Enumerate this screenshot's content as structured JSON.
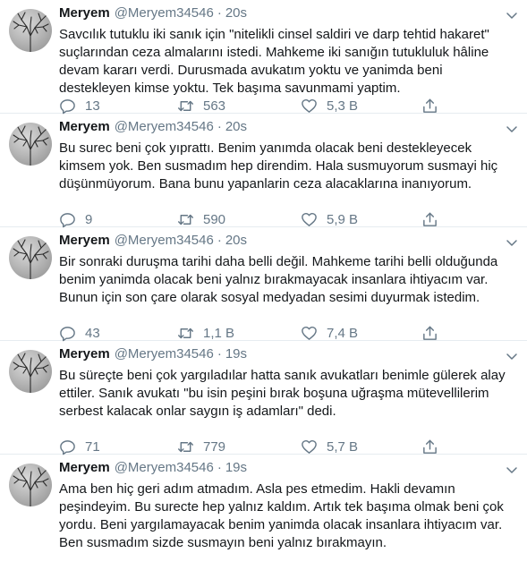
{
  "tweets": [
    {
      "name": "Meryem",
      "handle": "@Meryem34546",
      "dot": "·",
      "time": "20s",
      "lines": [
        "Savcılık tutuklu iki sanık için \"nitelikli cinsel saldiri ve darp tehtid hakaret\"",
        "suçlarından ceza almalarını istedi. Mahkeme iki sanığın tutukluluk hâline",
        "devam kararı verdi. Durusmada avukatım yoktu ve yanimda beni",
        "destekleyen kimse yoktu. Tek başıma savunmami yaptim."
      ],
      "replies": "13",
      "retweets": "563",
      "likes": "5,3 B"
    },
    {
      "name": "Meryem",
      "handle": "@Meryem34546",
      "dot": "·",
      "time": "20s",
      "lines": [
        "Bu surec beni çok yıprattı. Benim yanımda olacak beni destekleyecek",
        "kimsem yok. Ben susmadım hep direndim. Hala susmuyorum susmayi hiç",
        "düşünmüyorum. Bana bunu yapanlarin ceza alacaklarına inanıyorum."
      ],
      "replies": "9",
      "retweets": "590",
      "likes": "5,9 B"
    },
    {
      "name": "Meryem",
      "handle": "@Meryem34546",
      "dot": "·",
      "time": "20s",
      "lines": [
        "Bir sonraki duruşma tarihi daha belli değil. Mahkeme tarihi belli olduğunda",
        "benim yanimda olacak beni yalnız bırakmayacak insanlara ihtiyacım var.",
        "Bunun için son çare olarak sosyal medyadan sesimi duyurmak istedim."
      ],
      "replies": "43",
      "retweets": "1,1 B",
      "likes": "7,4 B"
    },
    {
      "name": "Meryem",
      "handle": "@Meryem34546",
      "dot": "·",
      "time": "19s",
      "lines": [
        "Bu süreçte beni çok yargıladılar hatta sanık avukatları benimle gülerek alay",
        "ettiler. Sanık avukatı \"bu isin peşini bırak boşuna uğraşma mütevellilerim",
        "serbest kalacak onlar saygın iş adamları\" dedi."
      ],
      "replies": "71",
      "retweets": "779",
      "likes": "5,7 B"
    },
    {
      "name": "Meryem",
      "handle": "@Meryem34546",
      "dot": "·",
      "time": "19s",
      "lines": [
        "Ama ben hiç geri adım atmadım. Asla pes etmedim. Hakli devamın",
        "peşindeyim. Bu surecte hep yalnız kaldım. Artık tek başıma olmak beni çok",
        "yordu. Beni yargılamayacak benim yanimda olacak insanlara ihtiyacım var.",
        "Ben susmadım sizde susmayın beni yalnız bırakmayın."
      ]
    }
  ],
  "icons": {
    "avatar": "bare-tree-silhouette",
    "caret": "chevron-down-icon",
    "reply": "reply-icon",
    "retweet": "retweet-icon",
    "like": "heart-icon",
    "share": "share-icon"
  },
  "colors": {
    "text": "#14171a",
    "muted": "#657786",
    "divider": "#e6ecf0"
  }
}
